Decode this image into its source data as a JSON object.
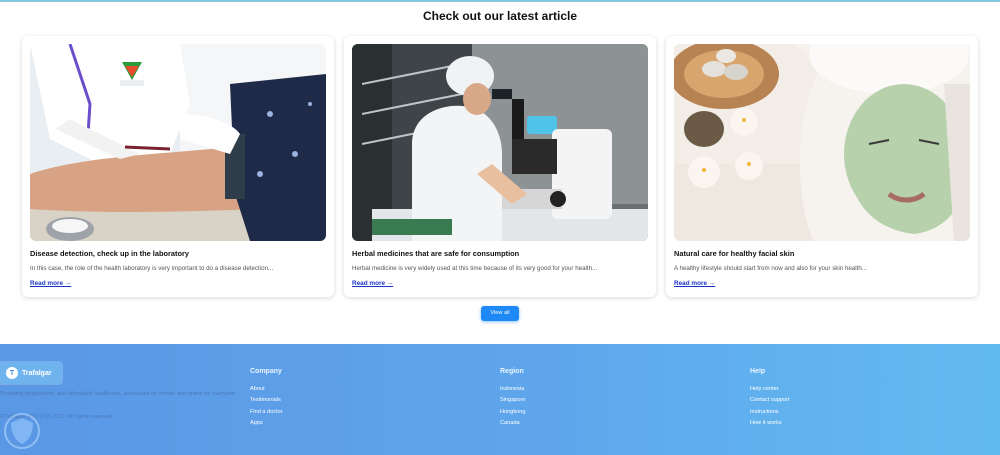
{
  "section": {
    "title": "Check out our latest article"
  },
  "articles": [
    {
      "title": "Disease detection, check up in the laboratory",
      "desc": "In this case, the role of the health laboratory is very important to do a disease detection...",
      "read_more": "Read more →"
    },
    {
      "title": "Herbal medicines that are safe for consumption",
      "desc": "Herbal medicine is very widely used at this time because of its very good for your health...",
      "read_more": "Read more →"
    },
    {
      "title": "Natural care for healthy facial skin",
      "desc": "A healthy lifestyle should start from now and also for your skin health...",
      "read_more": "Read more →"
    }
  ],
  "view_all_label": "View all",
  "footer": {
    "brand": {
      "logo_letter": "T",
      "name": "Trafalgar"
    },
    "tagline": "Providing progressive, and affordable healthcare, accessible on mobile and online for everyone",
    "copyright": "©Trafalgar PTY LTD 2022. All rights reserved",
    "columns": [
      {
        "heading": "Company",
        "links": [
          "About",
          "Testimonials",
          "Find a doctor",
          "Apps"
        ]
      },
      {
        "heading": "Region",
        "links": [
          "Indonesia",
          "Singapore",
          "Hongkong",
          "Canada"
        ]
      },
      {
        "heading": "Help",
        "links": [
          "Help center",
          "Contact support",
          "Instructions",
          "How it works"
        ]
      }
    ]
  },
  "colors": {
    "accent": "#1e88f5",
    "footer_start": "#5a97e5",
    "footer_end": "#62bbf0",
    "link": "#1a33c8"
  }
}
